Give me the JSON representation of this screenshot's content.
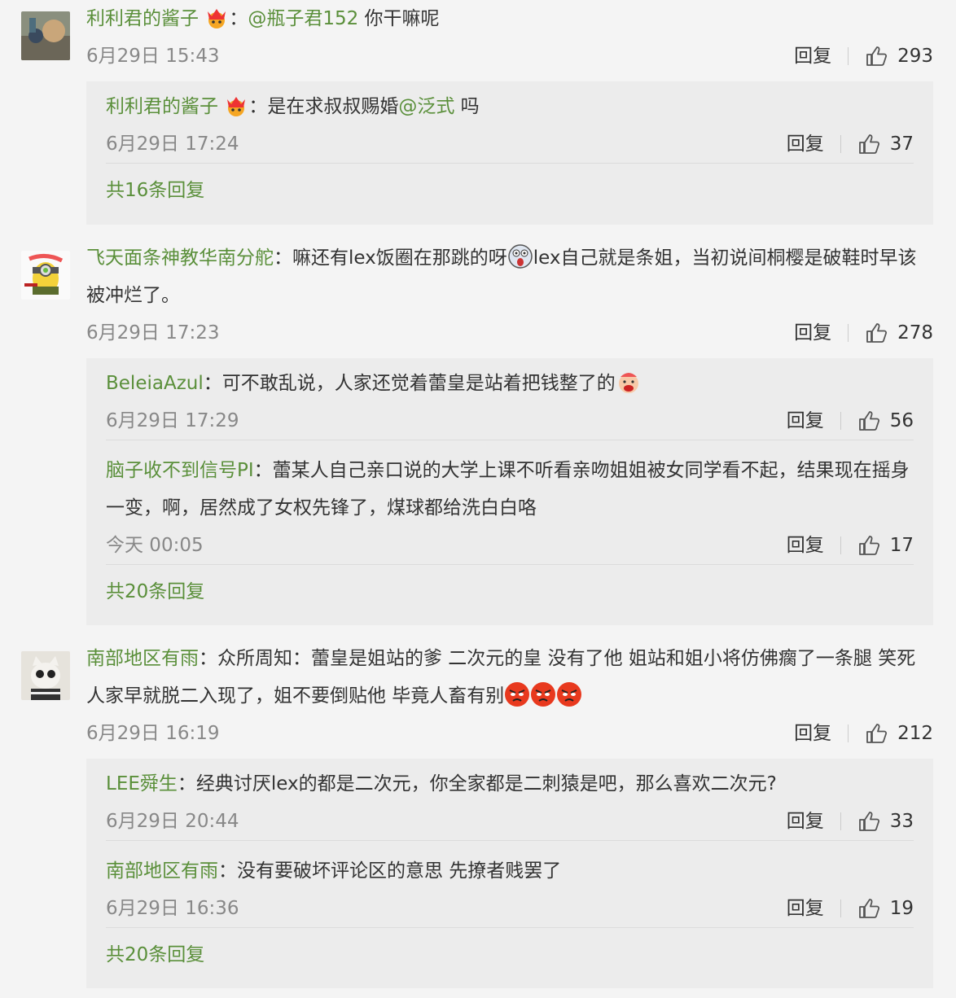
{
  "labels": {
    "reply": "回复"
  },
  "colors": {
    "username": "#5a8f3a",
    "text": "#333333",
    "time": "#888888",
    "reply_bg": "#ececec",
    "bg": "#f4f4f4"
  },
  "comments": [
    {
      "user": "利利君的酱子",
      "badge_icon": "crown-badge-icon",
      "mention": "@瓶子君152",
      "text": " 你干嘛呢",
      "time": "6月29日 15:43",
      "likes": "293",
      "replies": [
        {
          "user": "利利君的酱子",
          "badge_icon": "crown-badge-icon",
          "text_pre": "是在求叔叔赐婚",
          "mention": "@泛式",
          "text_post": " 吗",
          "time": "6月29日 17:24",
          "likes": "37"
        }
      ],
      "more": "共16条回复"
    },
    {
      "user": "飞天面条神教华南分舵",
      "text": "嘛还有lex饭圈在那跳的呀",
      "emoji": "scared-face-icon",
      "text2": "lex自己就是条姐，当初说间桐樱是破鞋时早该被冲烂了。",
      "time": "6月29日 17:23",
      "likes": "278",
      "replies": [
        {
          "user": "BeleiaAzul",
          "text": "可不敢乱说，人家还觉着蕾皇是站着把钱整了的",
          "emoji": "crying-face-icon",
          "time": "6月29日 17:29",
          "likes": "56"
        },
        {
          "user": "脑子收不到信号PI",
          "text": "蕾某人自己亲口说的大学上课不听看亲吻姐姐被女同学看不起，结果现在摇身一变，啊，居然成了女权先锋了，煤球都给洗白白咯",
          "time": "今天 00:05",
          "likes": "17"
        }
      ],
      "more": "共20条回复"
    },
    {
      "user": "南部地区有雨",
      "text": "众所周知：蕾皇是姐站的爹 二次元的皇 没有了他 姐站和姐小将仿佛瘸了一条腿 笑死 人家早就脱二入现了，姐不要倒贴他 毕竟人畜有别",
      "emoji": "angry-face-icon",
      "time": "6月29日 16:19",
      "likes": "212",
      "replies": [
        {
          "user": "LEE舜生",
          "text": "经典讨厌lex的都是二次元，你全家都是二刺猿是吧，那么喜欢二次元?",
          "time": "6月29日 20:44",
          "likes": "33"
        },
        {
          "user": "南部地区有雨",
          "text": "没有要破坏评论区的意思 先撩者贱罢了",
          "time": "6月29日 16:36",
          "likes": "19"
        }
      ],
      "more": "共20条回复"
    }
  ]
}
